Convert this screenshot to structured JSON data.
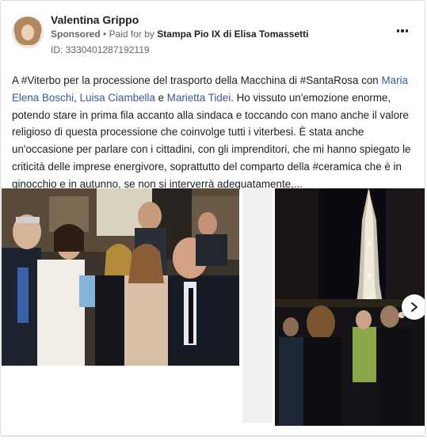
{
  "post": {
    "author": "Valentina Grippo",
    "sponsored_label": "Sponsored",
    "separator": "•",
    "paid_for_prefix": "Paid for by",
    "payer": "Stampa Pio IX di Elisa Tomassetti",
    "ad_id": "ID: 3330401287192119",
    "text": {
      "part1": "A #Viterbo per la processione del trasporto della Macchina di #SantaRosa con ",
      "mention1": "Maria Elena Boschi",
      "sep1": ", ",
      "mention2": "Luisa Ciambella",
      "sep2": " e ",
      "mention3": "Marietta Tidei",
      "part2": ". Ho vissuto un'emozione enorme, potendo stare in prima fila accanto alla sindaca e toccando con mano anche il valore religioso di questa processione che coinvolge tutti i viterbesi. È stata anche un'occasione per parlare con i cittadini, con gli imprenditori, che mi hanno spiegato le criticità delle imprese energivore, soprattutto del comparto della #ceramica che è in ginocchio e in autunno, se non si interverrà adeguatamente,..."
    }
  },
  "icons": {
    "more": "more-horizontal-icon",
    "next": "chevron-right-icon"
  },
  "colors": {
    "link": "#3b5998",
    "text": "#1c1e21",
    "muted": "#65676b"
  }
}
